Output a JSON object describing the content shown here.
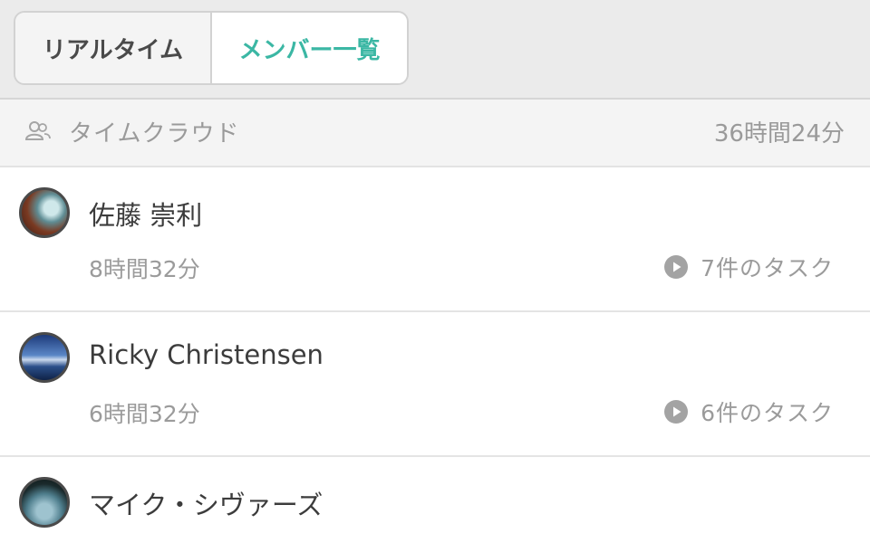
{
  "tabs": {
    "realtime_label": "リアルタイム",
    "members_label": "メンバー一覧",
    "active_color": "#3bb7a4"
  },
  "team": {
    "icon": "users-icon",
    "name": "タイムクラウド",
    "total_time": "36時間24分"
  },
  "members": [
    {
      "name": "佐藤 崇利",
      "time": "8時間32分",
      "tasks": "7件のタスク",
      "task_icon": "play-circle-icon"
    },
    {
      "name": "Ricky Christensen",
      "time": "6時間32分",
      "tasks": "6件のタスク",
      "task_icon": "play-circle-icon"
    },
    {
      "name": "マイク・シヴァーズ"
    }
  ]
}
